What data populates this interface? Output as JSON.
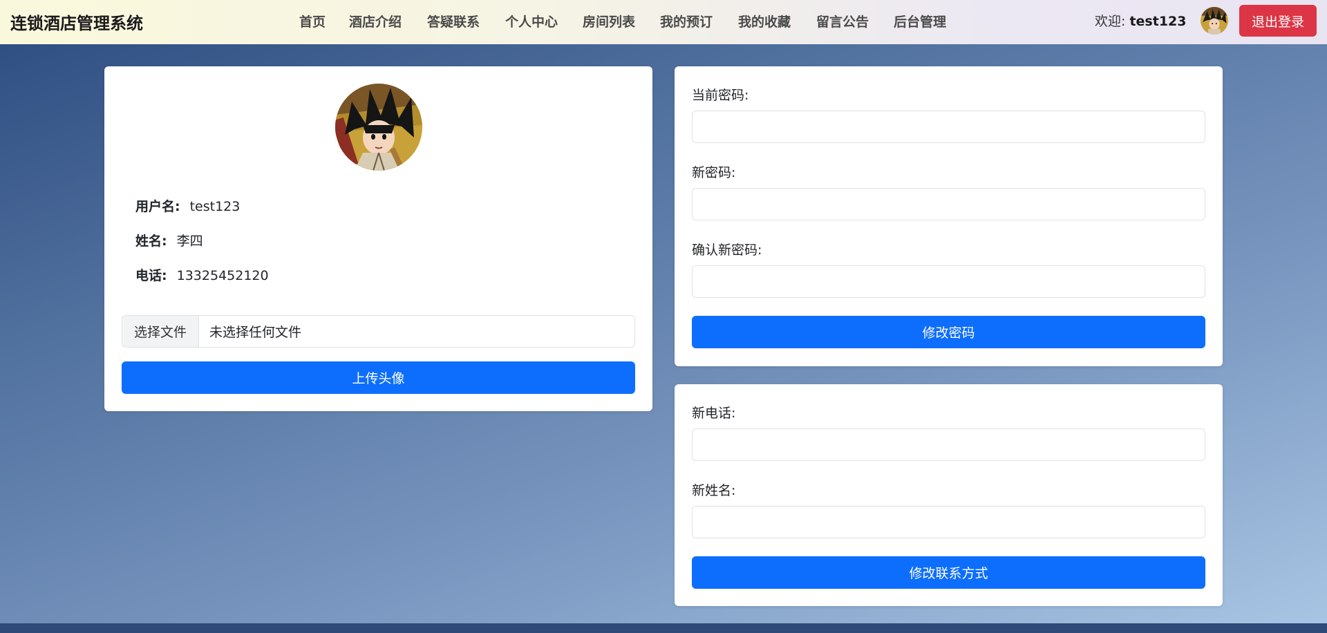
{
  "navbar": {
    "brand": "连锁酒店管理系统",
    "links": [
      "首页",
      "酒店介绍",
      "答疑联系",
      "个人中心",
      "房间列表",
      "我的预订",
      "我的收藏",
      "留言公告",
      "后台管理"
    ],
    "welcome_prefix": "欢迎:",
    "username": "test123",
    "logout_label": "退出登录"
  },
  "profile": {
    "username_label": "用户名:",
    "username_value": "test123",
    "name_label": "姓名:",
    "name_value": "李四",
    "phone_label": "电话:",
    "phone_value": "13325452120",
    "file_button_label": "选择文件",
    "file_status": "未选择任何文件",
    "upload_label": "上传头像"
  },
  "password_form": {
    "current_label": "当前密码:",
    "new_label": "新密码:",
    "confirm_label": "确认新密码:",
    "submit_label": "修改密码"
  },
  "contact_form": {
    "phone_label": "新电话:",
    "name_label": "新姓名:",
    "submit_label": "修改联系方式"
  },
  "icons": {
    "avatar": "avatar-anime-boy-icon"
  },
  "colors": {
    "primary": "#0d6efd",
    "danger": "#dc3545"
  }
}
